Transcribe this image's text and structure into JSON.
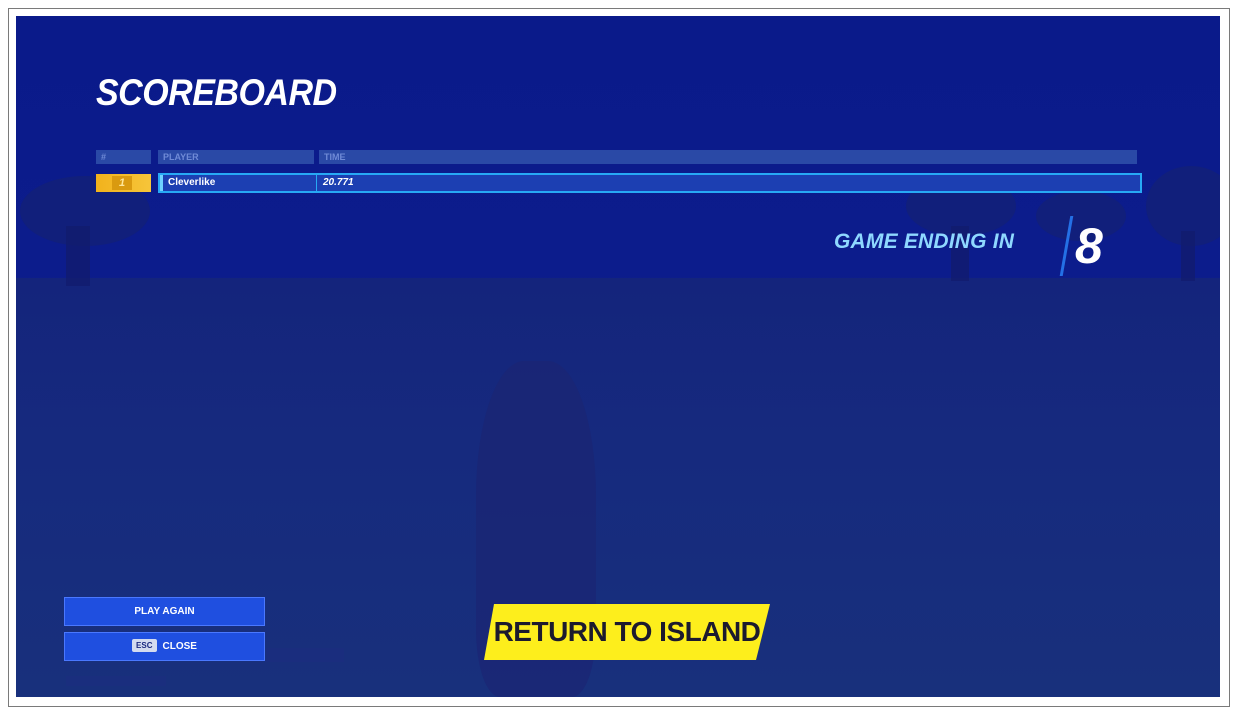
{
  "scoreboard": {
    "title": "SCOREBOARD",
    "columns": [
      "#",
      "PLAYER",
      "TIME"
    ],
    "rows": [
      {
        "rank": "1",
        "player": "Cleverlike",
        "time": "20.771"
      }
    ]
  },
  "countdown": {
    "label": "GAME ENDING IN",
    "seconds": "8"
  },
  "buttons": {
    "play_again": "PLAY AGAIN",
    "close_key": "ESC",
    "close": "CLOSE",
    "return_to_island": "RETURN TO ISLAND"
  },
  "colors": {
    "background": "#0c1c8c",
    "accent_blue": "#27a9f5",
    "rank_gold": "#f2b21c",
    "return_yellow": "#fdee1c",
    "countdown_label": "#8fd8ff"
  }
}
